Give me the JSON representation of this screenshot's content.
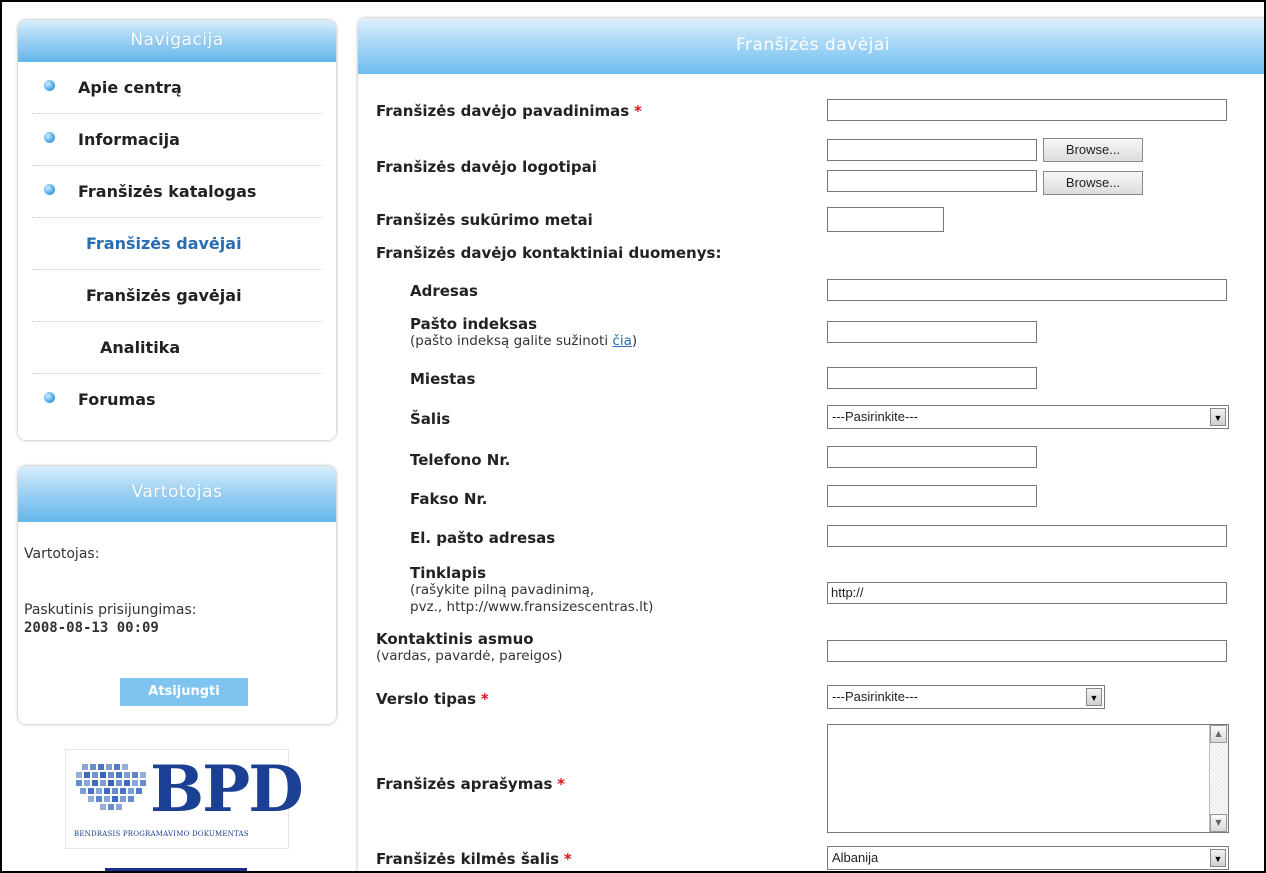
{
  "navigation": {
    "title": "Navigacija",
    "items": [
      {
        "label": "Apie centrą"
      },
      {
        "label": "Informacija"
      },
      {
        "label": "Franšizės katalogas"
      },
      {
        "label": "Franšizės davėjai"
      },
      {
        "label": "Franšizės gavėjai"
      },
      {
        "label": "Analitika"
      },
      {
        "label": "Forumas"
      }
    ]
  },
  "user": {
    "title": "Vartotojas",
    "user_label": "Vartotojas:",
    "last_login_label": "Paskutinis prisijungimas:",
    "last_login_value": "2008-08-13 00:09",
    "logout_label": "Atsijungti"
  },
  "logo": {
    "text": "BPD",
    "caption": "BENDRASIS PROGRAMAVIMO DOKUMENTAS"
  },
  "form": {
    "title": "Franšizės davėjai",
    "name_label": "Franšizės davėjo pavadinimas",
    "logos_label": "Franšizės davėjo logotipai",
    "browse_label": "Browse...",
    "year_label": "Franšizės sukūrimo metai",
    "contacts_label": "Franšizės davėjo kontaktiniai duomenys:",
    "address_label": "Adresas",
    "postcode_label": "Pašto indeksas",
    "postcode_hint_prefix": "(pašto indeksą galite sužinoti ",
    "postcode_hint_link": "čia",
    "postcode_hint_suffix": ")",
    "city_label": "Miestas",
    "country_label": "Šalis",
    "country_value": "---Pasirinkite---",
    "phone_label": "Telefono Nr.",
    "fax_label": "Fakso Nr.",
    "email_label": "El. pašto adresas",
    "website_label": "Tinklapis",
    "website_hint_1": "(rašykite pilną pavadinimą,",
    "website_hint_2": "pvz., http://www.fransizescentras.lt)",
    "website_value": "http://",
    "contact_person_label": "Kontaktinis asmuo",
    "contact_person_hint": "(vardas, pavardė, pareigos)",
    "business_type_label": "Verslo tipas",
    "business_type_value": "---Pasirinkite---",
    "description_label": "Franšizės aprašymas",
    "origin_label": "Franšizės kilmės šalis",
    "origin_value": "Albanija",
    "required_mark": "*"
  }
}
